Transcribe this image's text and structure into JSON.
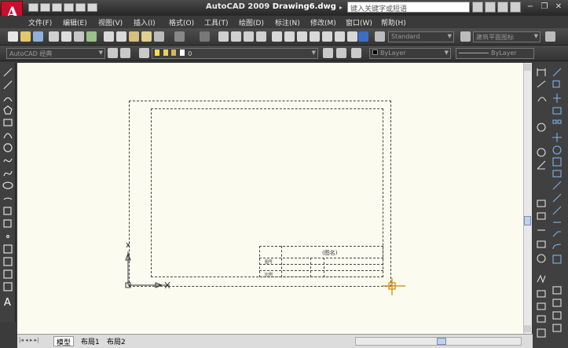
{
  "app": {
    "logo_letter": "A",
    "title_app": "AutoCAD 2009",
    "title_doc": "Drawing6.dwg",
    "search_placeholder": "键入关键字或短语"
  },
  "menus": [
    "文件(F)",
    "编辑(E)",
    "视图(V)",
    "插入(I)",
    "格式(O)",
    "工具(T)",
    "绘图(D)",
    "标注(N)",
    "修改(M)",
    "窗口(W)",
    "帮助(H)"
  ],
  "toolbar": {
    "text_style": "Standard",
    "dim_style": "建筑平面图标",
    "workspace": "AutoCAD 经典",
    "layer_value": "0",
    "color_value": "ByLayer",
    "linetype_value": "ByLayer"
  },
  "titleblock": {
    "title_text": "(图名)",
    "row2_text": "图号",
    "row3_text": "比例"
  },
  "tabs": [
    "模型",
    "布局1",
    "布局2"
  ],
  "colors": {
    "canvas": "#fcfbf0",
    "chrome": "#3b3b3b",
    "logo": "#c8102e"
  }
}
